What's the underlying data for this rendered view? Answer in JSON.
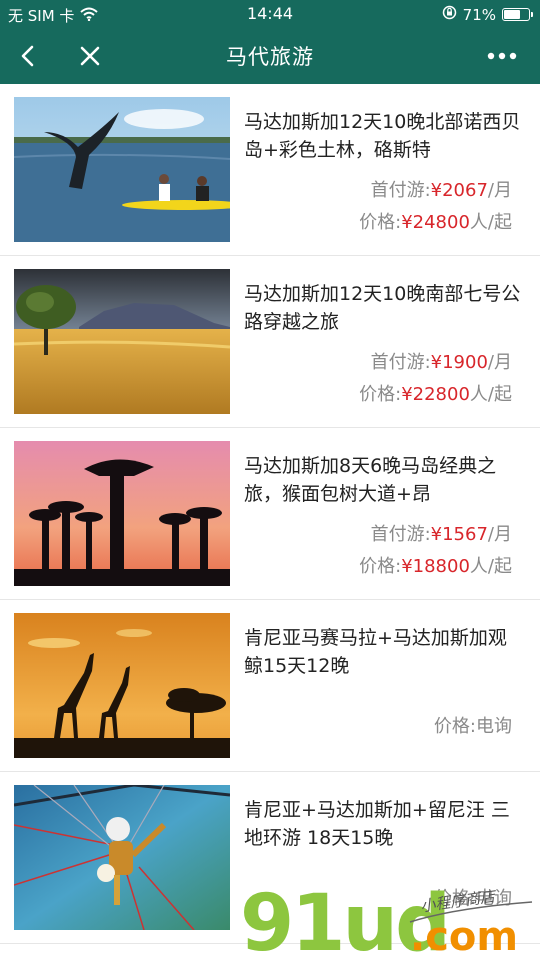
{
  "status": {
    "carrier": "无 SIM 卡",
    "time": "14:44",
    "battery": "71%",
    "battery_level": 0.71
  },
  "nav": {
    "title": "马代旅游"
  },
  "products": [
    {
      "title": "马达加斯加12天10晚北部诺西贝岛+彩色土林，硌斯特",
      "deposit_label": "首付游:",
      "deposit_price": "¥2067",
      "deposit_unit": "/月",
      "price_label": "价格:",
      "price": "¥24800",
      "price_unit": "人/起"
    },
    {
      "title": "马达加斯加12天10晚南部七号公路穿越之旅",
      "deposit_label": "首付游:",
      "deposit_price": "¥1900",
      "deposit_unit": "/月",
      "price_label": "价格:",
      "price": "¥22800",
      "price_unit": "人/起"
    },
    {
      "title": "马达加斯加8天6晚马岛经典之旅，猴面包树大道+昂",
      "deposit_label": "首付游:",
      "deposit_price": "¥1567",
      "deposit_unit": "/月",
      "price_label": "价格:",
      "price": "¥18800",
      "price_unit": "人/起"
    },
    {
      "title": "肯尼亚马赛马拉+马达加斯加观鲸15天12晚",
      "inquiry": "价格:电询"
    },
    {
      "title": "肯尼亚+马达加斯加+留尼汪 三地环游 18天15晚",
      "inquiry": "价格:电询"
    }
  ],
  "watermark": {
    "brand": "91ud",
    "domain": ".com",
    "tagline": "小程序商店"
  }
}
